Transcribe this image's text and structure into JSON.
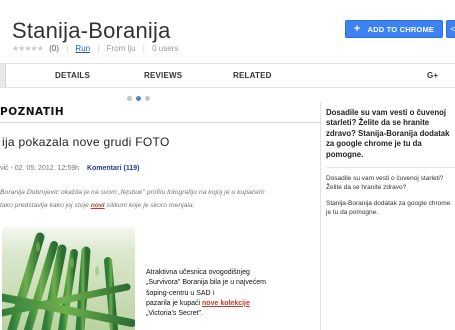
{
  "header": {
    "title": "Stanija-Boranija",
    "stars": "★★★★★",
    "rating_count": "(0)",
    "run_label": "Run",
    "from_label": "From lju",
    "users_label": "0 users",
    "add_button_label": "ADD TO CHROME",
    "add_button_icon": "plus-icon"
  },
  "tabs": [
    {
      "label": "DETAILS"
    },
    {
      "label": "REVIEWS"
    },
    {
      "label": "RELATED"
    }
  ],
  "tab_g_plus": "G+",
  "carousel": {
    "count": 3,
    "active": 2
  },
  "screenshot": {
    "section_title": "POZNATIH",
    "headline": "ija pokazala nove grudi FOTO",
    "byline_date": "vić - 02. 05. 2012. 12:59h",
    "comments_label": "Komentari (119)",
    "excerpt_part1": "Boranija Dobrojević okačila je na svom „fejsbuk\" profilu fotografiju na kojoj je u kupaćem",
    "excerpt_part2": "tako predstavlja kako joj stoje ",
    "excerpt_link": "novi",
    "excerpt_part3": " silikoni koje je skoro menjala.",
    "article_line1": "Atraktivna učesnica ovogodišnjeg",
    "article_line2": "„Survivora\" Boranija bila je u najvećem",
    "article_line3": "šoping-centru u SAD i",
    "article_line4_pre": "pazarila je kupaći ",
    "article_line4_link": "nove kolekcije",
    "article_line5": "„Victoria's Secret\"."
  },
  "sidebar": {
    "description": "Dosadile su vam vesti o čuvenoj starleti? Želite da se hranite zdravo? Stanija-Boranija dodatak za google chrome je tu da pomogne.",
    "short_question": "Dosadile su vam vesti o čuvenoj starleti? Želite da se hranite zdravo?",
    "short_info": "Stanija-Boranija dodatak za google chrome je tu da pomogne."
  },
  "colors": {
    "accent": "#3d82f4",
    "link_red": "#c0392b",
    "link_blue": "#1a5fb4"
  }
}
